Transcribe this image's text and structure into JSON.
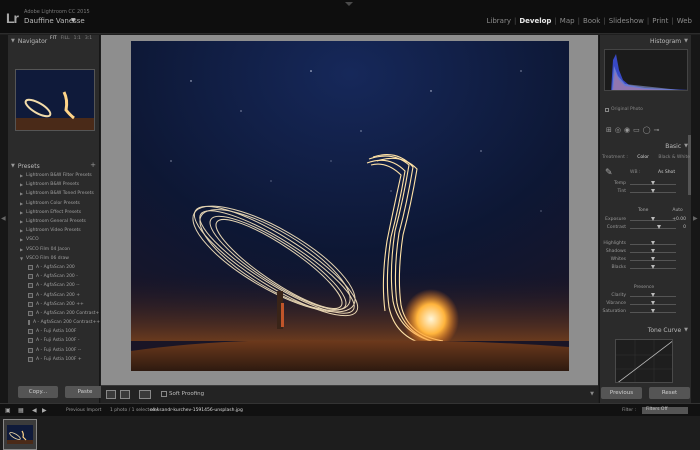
{
  "identity": {
    "logo": "Lr",
    "catalog": "Adobe Lightroom CC 2015",
    "user": "Dauffine Vanesse",
    "caret": "▼"
  },
  "modules": [
    "Library",
    "Develop",
    "Map",
    "Book",
    "Slideshow",
    "Print",
    "Web"
  ],
  "active_module": "Develop",
  "navigator": {
    "title": "Navigator",
    "zooms": [
      "FIT",
      "FILL",
      "1:1",
      "3:1"
    ]
  },
  "presets": {
    "title": "Presets",
    "add": "+",
    "items": [
      {
        "label": "Lightroom B&W Filter Presets",
        "child": false
      },
      {
        "label": "Lightroom B&W Presets",
        "child": false
      },
      {
        "label": "Lightroom B&W Toned Presets",
        "child": false
      },
      {
        "label": "Lightroom Color Presets",
        "child": false
      },
      {
        "label": "Lightroom Effect Presets",
        "child": false
      },
      {
        "label": "Lightroom General Presets",
        "child": false
      },
      {
        "label": "Lightroom Video Presets",
        "child": false
      },
      {
        "label": "VSCO",
        "child": false
      },
      {
        "label": "VSCO Film 04 Jacon",
        "child": false
      },
      {
        "label": "VSCO Film 06 draw",
        "child": false,
        "open": true
      },
      {
        "label": "A - AgfaScan 200",
        "child": true
      },
      {
        "label": "A - AgfaScan 200 -",
        "child": true
      },
      {
        "label": "A - AgfaScan 200 --",
        "child": true
      },
      {
        "label": "A - AgfaScan 200 +",
        "child": true
      },
      {
        "label": "A - AgfaScan 200 ++",
        "child": true
      },
      {
        "label": "A - AgfaScan 200 Contrast+",
        "child": true
      },
      {
        "label": "A - AgfaScan 200 Contrast++",
        "child": true
      },
      {
        "label": "A - Fuji Astia 100F",
        "child": true
      },
      {
        "label": "A - Fuji Astia 100F -",
        "child": true
      },
      {
        "label": "A - Fuji Astia 100F --",
        "child": true
      },
      {
        "label": "A - Fuji Astia 100F +",
        "child": true
      }
    ]
  },
  "left_buttons": {
    "copy": "Copy...",
    "paste": "Paste"
  },
  "toolbar": {
    "soft_proofing": "Soft Proofing",
    "caret": "▼"
  },
  "histogram": {
    "title": "Histogram",
    "original_photo": "Original Photo"
  },
  "basic": {
    "title": "Basic",
    "treatment_label": "Treatment :",
    "treatment_color": "Color",
    "treatment_bw": "Black & White",
    "wb_label": "WB :",
    "wb_value": "As Shot",
    "temp_label": "Temp",
    "tint_label": "Tint",
    "tone_label": "Tone",
    "tone_auto": "Auto",
    "exposure_label": "Exposure",
    "exposure_value": "+0.00",
    "contrast_label": "Contrast",
    "contrast_value": "0",
    "highlights_label": "Highlights",
    "shadows_label": "Shadows",
    "whites_label": "Whites",
    "blacks_label": "Blacks",
    "presence_label": "Presence",
    "clarity_label": "Clarity",
    "vibrance_label": "Vibrance",
    "saturation_label": "Saturation"
  },
  "slider_levels": {
    "temp": 0.5,
    "tint": 0.5,
    "exposure": 0.5,
    "contrast": 0.62,
    "highlights": 0.5,
    "shadows": 0.5,
    "whites": 0.5,
    "blacks": 0.5,
    "clarity": 0.5,
    "vibrance": 0.5,
    "saturation": 0.5
  },
  "tone_curve": {
    "title": "Tone Curve"
  },
  "right_buttons": {
    "previous": "Previous",
    "reset": "Reset"
  },
  "filmstrip": {
    "prev_import": "Previous Import",
    "count": "1 photo / 1 selected /",
    "filename": "oleksandr-kurchev-1591456-unsplash.jpg",
    "caret": "▼",
    "filter_label": "Filter :",
    "filter_value": "Filters Off"
  },
  "colors": {
    "accent": "#e6e6e6",
    "panel": "#2b2b2b",
    "center_bg": "#8e8e8e",
    "sky": "#0f1a3a"
  }
}
